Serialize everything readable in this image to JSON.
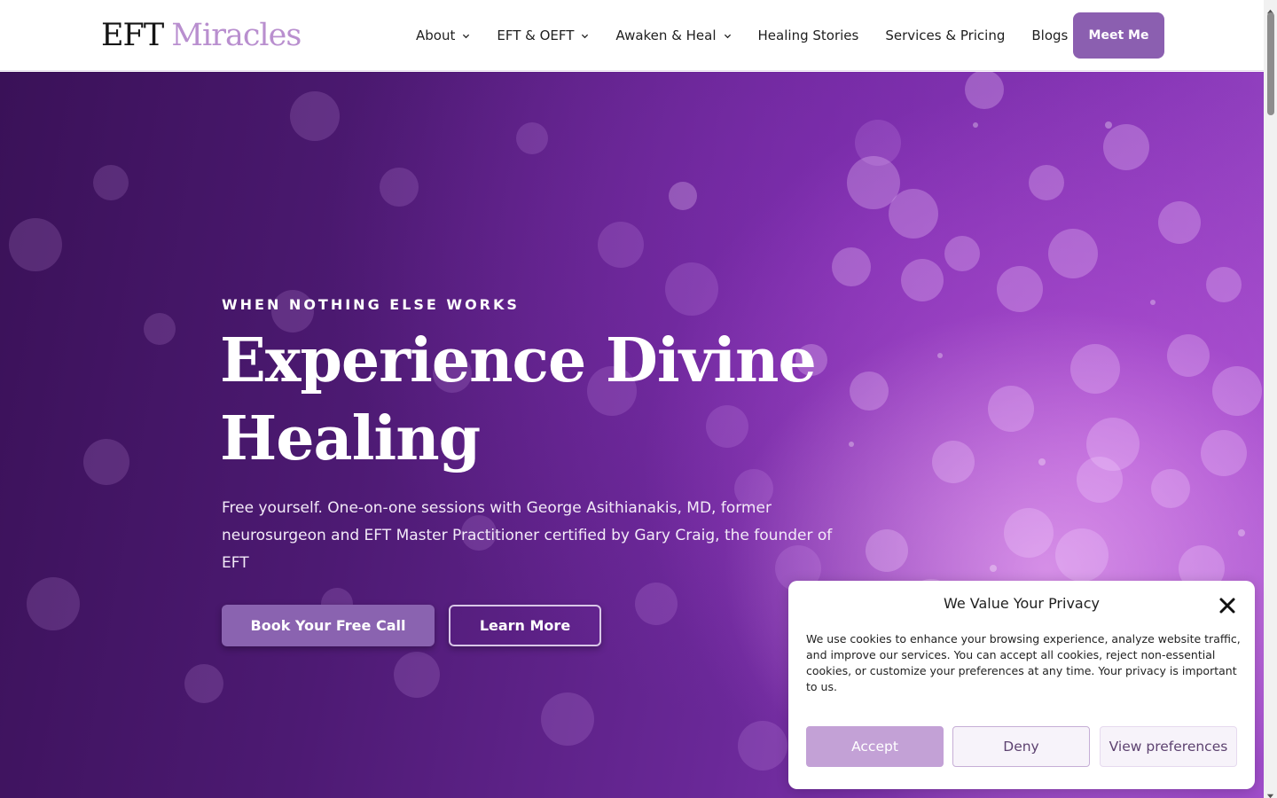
{
  "header": {
    "logo_part1": "EFT",
    "logo_part2": "Miracles",
    "nav": [
      {
        "label": "About",
        "has_dropdown": true
      },
      {
        "label": "EFT & OEFT",
        "has_dropdown": true
      },
      {
        "label": "Awaken & Heal",
        "has_dropdown": true
      },
      {
        "label": "Healing Stories",
        "has_dropdown": false
      },
      {
        "label": "Services & Pricing",
        "has_dropdown": false
      },
      {
        "label": "Blogs",
        "has_dropdown": false
      }
    ],
    "cta_label": "Meet Me"
  },
  "hero": {
    "eyebrow": "WHEN NOTHING ELSE WORKS",
    "title_line1": "Experience Divine",
    "title_line2": "Healing",
    "description": "Free yourself. One-on-one sessions with George Asithianakis, MD, former neurosurgeon and EFT Master Practitioner certified by Gary Craig, the founder of EFT",
    "primary_button": "Book Your Free Call",
    "secondary_button": "Learn More"
  },
  "cookie": {
    "title": "We Value Your Privacy",
    "text": "We use cookies to enhance your browsing experience, analyze website traffic, and improve our services. You can accept all cookies, reject non-essential cookies, or customize your preferences at any time. Your privacy is important to us.",
    "accept_label": "Accept",
    "deny_label": "Deny",
    "prefs_label": "View preferences"
  },
  "colors": {
    "brand_purple": "#8b5fb0",
    "logo_accent": "#b98fcf",
    "hero_dark": "#3a1158",
    "hero_light": "#9c4cc8",
    "accept_bg": "#c3a1d6"
  },
  "icons": {
    "nav_dropdown": "chevron-down-icon",
    "cookie_close": "close-icon"
  }
}
